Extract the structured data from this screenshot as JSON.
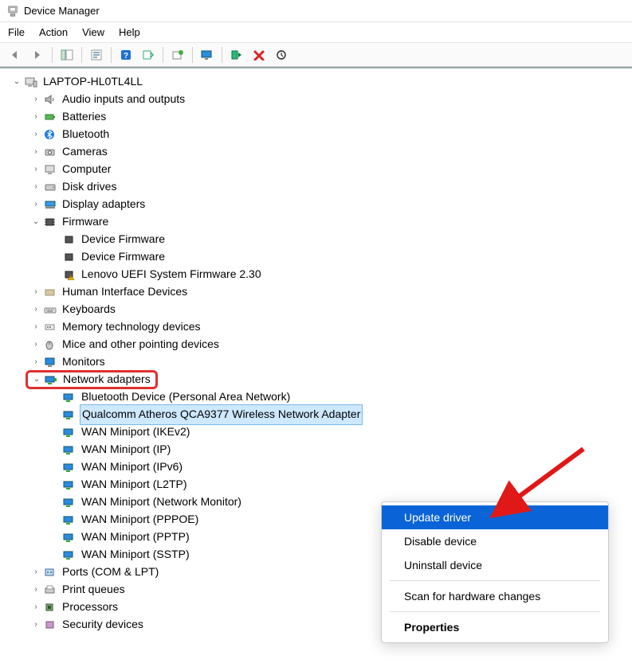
{
  "app": {
    "title": "Device Manager"
  },
  "menubar": [
    "File",
    "Action",
    "View",
    "Help"
  ],
  "tree": {
    "root": "LAPTOP-HL0TL4LL",
    "items": [
      {
        "label": "Audio inputs and outputs",
        "expanded": false
      },
      {
        "label": "Batteries",
        "expanded": false
      },
      {
        "label": "Bluetooth",
        "expanded": false
      },
      {
        "label": "Cameras",
        "expanded": false
      },
      {
        "label": "Computer",
        "expanded": false
      },
      {
        "label": "Disk drives",
        "expanded": false
      },
      {
        "label": "Display adapters",
        "expanded": false
      },
      {
        "label": "Firmware",
        "expanded": true,
        "children": [
          "Device Firmware",
          "Device Firmware",
          "Lenovo UEFI System Firmware 2.30"
        ]
      },
      {
        "label": "Human Interface Devices",
        "expanded": false
      },
      {
        "label": "Keyboards",
        "expanded": false
      },
      {
        "label": "Memory technology devices",
        "expanded": false
      },
      {
        "label": "Mice and other pointing devices",
        "expanded": false
      },
      {
        "label": "Monitors",
        "expanded": false
      },
      {
        "label": "Network adapters",
        "expanded": true,
        "highlighted": true,
        "children": [
          "Bluetooth Device (Personal Area Network)",
          "Qualcomm Atheros QCA9377 Wireless Network Adapter",
          "WAN Miniport (IKEv2)",
          "WAN Miniport (IP)",
          "WAN Miniport (IPv6)",
          "WAN Miniport (L2TP)",
          "WAN Miniport (Network Monitor)",
          "WAN Miniport (PPPOE)",
          "WAN Miniport (PPTP)",
          "WAN Miniport (SSTP)"
        ],
        "selected_child_index": 1
      },
      {
        "label": "Ports (COM & LPT)",
        "expanded": false
      },
      {
        "label": "Print queues",
        "expanded": false
      },
      {
        "label": "Processors",
        "expanded": false
      },
      {
        "label": "Security devices",
        "expanded": false
      }
    ]
  },
  "context_menu": {
    "items": [
      {
        "label": "Update driver",
        "highlighted": true
      },
      {
        "label": "Disable device"
      },
      {
        "label": "Uninstall device"
      },
      {
        "sep": true
      },
      {
        "label": "Scan for hardware changes"
      },
      {
        "sep": true
      },
      {
        "label": "Properties",
        "bold": true
      }
    ]
  }
}
